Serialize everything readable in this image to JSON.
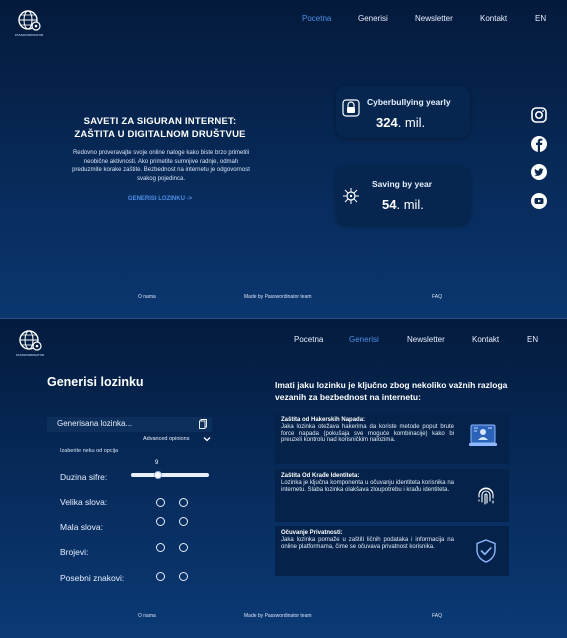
{
  "brand": {
    "logo_text": "PASSWORDINATOR"
  },
  "page1": {
    "nav": {
      "home": "Pocetna",
      "generate": "Generisi",
      "newsletter": "Newsletter",
      "contact": "Kontakt",
      "lang": "EN",
      "active": "home"
    },
    "hero": {
      "title_line1": "SAVETI ZA SIGURAN INTERNET:",
      "title_line2": "ZAŠTITA U DIGITALNOM DRUŠTVUE",
      "text": "Redovno proveravajte svoje online naloge kako biste brzo primetili neobične aktivnosti. Ako primetite sumnjive radnje, odmah preduzmite korake zaštite. Bezbednost na internetu je odgovornost svakog pojedinca.",
      "link": "GENERISI LOZINKU ->"
    },
    "stats": [
      {
        "icon": "lock-icon",
        "label": "Cyberbullying yearly",
        "value": "324",
        "unit": ". mil."
      },
      {
        "icon": "virus-icon",
        "label": "Saving by year",
        "value": "54",
        "unit": ". mil."
      }
    ],
    "social": [
      "instagram-icon",
      "facebook-icon",
      "twitter-icon",
      "youtube-icon"
    ],
    "footer": {
      "about": "O nama",
      "made_by": "Made by Passwordinator team",
      "faq": "FAQ"
    }
  },
  "page2": {
    "nav": {
      "home": "Pocetna",
      "generate": "Generisi",
      "newsletter": "Newsletter",
      "contact": "Kontakt",
      "lang": "EN",
      "active": "generate"
    },
    "generator": {
      "title": "Generisi lozinku",
      "field_placeholder": "Generisana lozinka...",
      "advanced": "Advanced opinions",
      "choose": "Izaberite neku od opcija",
      "length_label": "Duzina sifre:",
      "length_value": "9",
      "length_fraction": 0.35,
      "options": [
        {
          "label": "Velika slova:"
        },
        {
          "label": "Mala slova:"
        },
        {
          "label": "Brojevi:"
        },
        {
          "label": "Posebni znakovi:"
        }
      ]
    },
    "info": {
      "title": "Imati jaku lozinku je ključno zbog nekoliko važnih razloga vezanih za bezbednost na internetu:",
      "cards": [
        {
          "head": "Zaštita od Hakerskih Napada:",
          "body": "Jaka lozinka otežava hakerima da koriste metode poput brute force napada (pokušaja sve moguće kombinacije) kako bi preuzeli kontrolu nad korisničkim nalozima.",
          "icon": "hacker-laptop-icon"
        },
        {
          "head": "Zaštita Od Krađe Identiteta:",
          "body": "Lozinka je ključna komponenta u očuvanju identiteta korisnika na internetu. Slaba lozinka olakšava zloupotrebu i krađu identiteta.",
          "icon": "fingerprint-icon"
        },
        {
          "head": "Očuvanje Privatnosti:",
          "body": "Jaka lozinka pomaže u zaštiti ličnih podataka i informacija na online platformama, čime se očuvava privatnost korisnika.",
          "icon": "shield-check-icon"
        }
      ]
    },
    "footer": {
      "about": "O nama",
      "made_by": "Made by Passwordinator team",
      "faq": "FAQ"
    }
  }
}
